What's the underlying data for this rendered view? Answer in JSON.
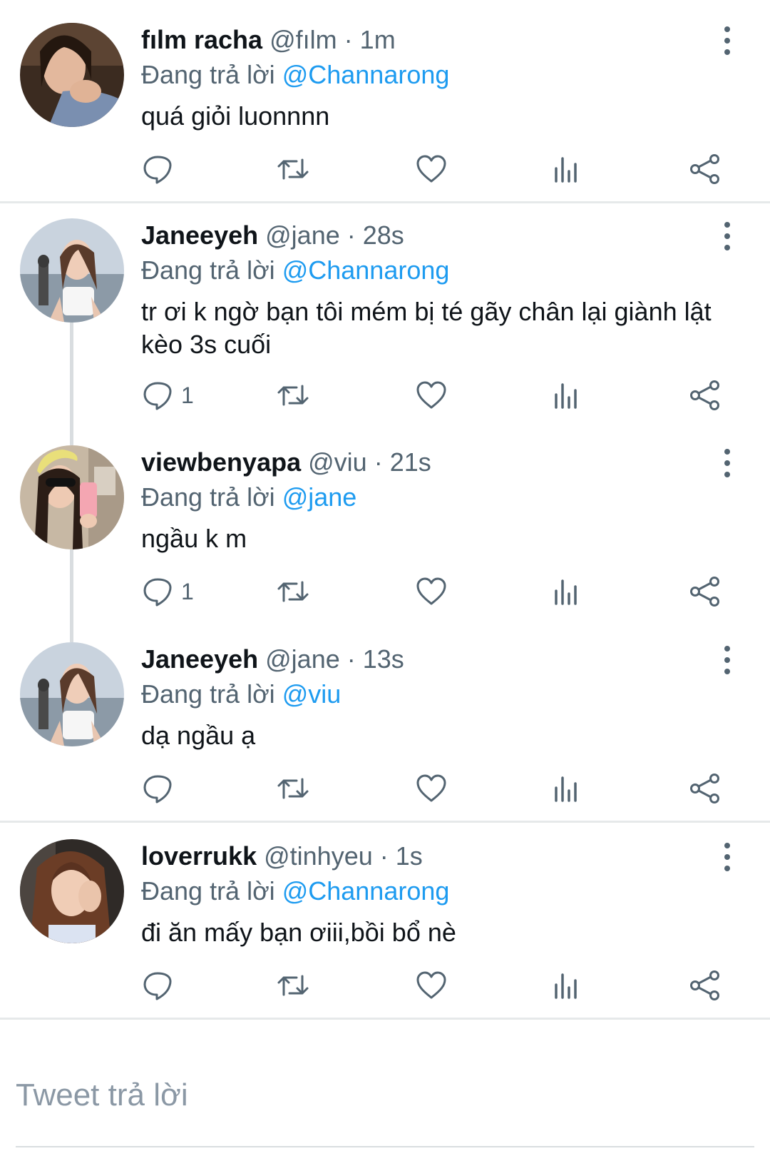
{
  "tweets": [
    {
      "name": "fılm racha",
      "handle": "@fılm",
      "time": "1m",
      "reply_prefix": "Đang trả lời",
      "reply_to": "@Channarong",
      "text": "quá giỏi luonnnn",
      "reply_count": ""
    },
    {
      "name": "Janeeyeh",
      "handle": "@jane",
      "time": "28s",
      "reply_prefix": "Đang trả lời",
      "reply_to": "@Channarong",
      "text": "tr ơi k ngờ bạn tôi mém bị té gãy chân lại giành lật kèo 3s cuối",
      "reply_count": "1"
    },
    {
      "name": "viewbenyapa",
      "handle": "@viu",
      "time": "21s",
      "reply_prefix": "Đang trả lời",
      "reply_to": "@jane",
      "text": "ngầu k m",
      "reply_count": "1"
    },
    {
      "name": "Janeeyeh",
      "handle": "@jane",
      "time": "13s",
      "reply_prefix": "Đang trả lời",
      "reply_to": "@viu",
      "text": "dạ ngầu ạ",
      "reply_count": ""
    },
    {
      "name": "loverrukk",
      "handle": "@tinhyeu",
      "time": "1s",
      "reply_prefix": "Đang trả lời",
      "reply_to": "@Channarong",
      "text": "đi ăn mấy bạn ơiii,bồi bổ nè",
      "reply_count": ""
    }
  ],
  "separator": "·",
  "compose": {
    "placeholder": "Tweet trả lời"
  },
  "icons": {
    "reply": "reply-icon",
    "retweet": "retweet-icon",
    "like": "heart-icon",
    "views": "views-icon",
    "share": "share-icon",
    "more": "more-vertical-icon"
  },
  "colors": {
    "accent": "#1d9bf0",
    "muted": "#536471",
    "text": "#0f1419"
  }
}
